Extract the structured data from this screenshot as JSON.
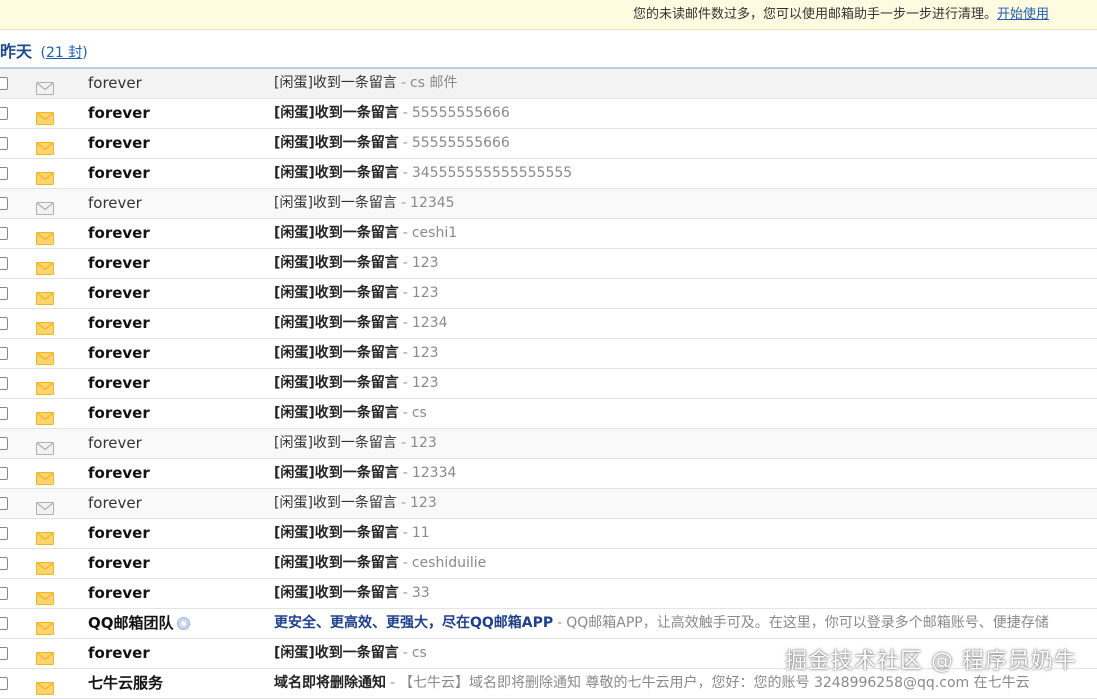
{
  "notice": {
    "text": "您的未读邮件数过多，您可以使用邮箱助手一步一步进行清理。",
    "link": "开始使用"
  },
  "group": {
    "title": "昨天",
    "count": "21 封"
  },
  "mails": [
    {
      "read": true,
      "sender": "forever",
      "subject": "[闲蛋]收到一条留言",
      "preview": "cs 邮件"
    },
    {
      "read": false,
      "sender": "forever",
      "subject": "[闲蛋]收到一条留言",
      "preview": "55555555666"
    },
    {
      "read": false,
      "sender": "forever",
      "subject": "[闲蛋]收到一条留言",
      "preview": "55555555666"
    },
    {
      "read": false,
      "sender": "forever",
      "subject": "[闲蛋]收到一条留言",
      "preview": "345555555555555555"
    },
    {
      "read": true,
      "sender": "forever",
      "subject": "[闲蛋]收到一条留言",
      "preview": "12345"
    },
    {
      "read": false,
      "sender": "forever",
      "subject": "[闲蛋]收到一条留言",
      "preview": "ceshi1"
    },
    {
      "read": false,
      "sender": "forever",
      "subject": "[闲蛋]收到一条留言",
      "preview": "123"
    },
    {
      "read": false,
      "sender": "forever",
      "subject": "[闲蛋]收到一条留言",
      "preview": "123"
    },
    {
      "read": false,
      "sender": "forever",
      "subject": "[闲蛋]收到一条留言",
      "preview": "1234"
    },
    {
      "read": false,
      "sender": "forever",
      "subject": "[闲蛋]收到一条留言",
      "preview": "123"
    },
    {
      "read": false,
      "sender": "forever",
      "subject": "[闲蛋]收到一条留言",
      "preview": "123"
    },
    {
      "read": false,
      "sender": "forever",
      "subject": "[闲蛋]收到一条留言",
      "preview": "cs"
    },
    {
      "read": true,
      "sender": "forever",
      "subject": "[闲蛋]收到一条留言",
      "preview": "123"
    },
    {
      "read": false,
      "sender": "forever",
      "subject": "[闲蛋]收到一条留言",
      "preview": "12334"
    },
    {
      "read": true,
      "sender": "forever",
      "subject": "[闲蛋]收到一条留言",
      "preview": "123"
    },
    {
      "read": false,
      "sender": "forever",
      "subject": "[闲蛋]收到一条留言",
      "preview": "11"
    },
    {
      "read": false,
      "sender": "forever",
      "subject": "[闲蛋]收到一条留言",
      "preview": "ceshiduilie"
    },
    {
      "read": false,
      "sender": "forever",
      "subject": "[闲蛋]收到一条留言",
      "preview": "33"
    },
    {
      "read": false,
      "sender": "QQ邮箱团队",
      "subject": "更安全、更高效、更强大，尽在QQ邮箱APP",
      "preview": "QQ邮箱APP，让高效触手可及。在这里，你可以登录多个邮箱账号、便捷存储",
      "blue": true,
      "verified": true
    },
    {
      "read": false,
      "sender": "forever",
      "subject": "[闲蛋]收到一条留言",
      "preview": "cs"
    },
    {
      "read": false,
      "sender": "七牛云服务",
      "subject": "域名即将删除通知",
      "preview": "【七牛云】域名即将删除通知   尊敬的七牛云用户，您好：您的账号  3248996258@qq.com  在七牛云"
    }
  ],
  "watermark": "掘金技术社区 @ 程序员奶牛",
  "colors": {
    "unread_envelope": "#f0b429",
    "read_envelope": "#b0b0b0",
    "header_blue": "#1e4b8a",
    "link_blue": "#1f5fb4"
  }
}
